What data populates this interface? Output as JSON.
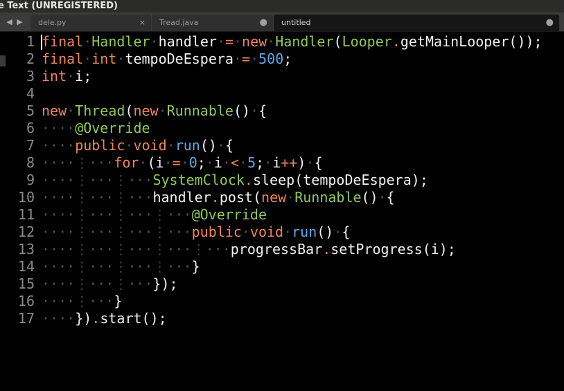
{
  "window": {
    "title": "e Text (UNREGISTERED)"
  },
  "tabbar": {
    "nav_prev": "◀",
    "nav_next": "▶",
    "tabs": [
      {
        "label": "dele.py",
        "marker": "×",
        "active": false
      },
      {
        "label": "Tread.java",
        "marker": "●",
        "active": false
      },
      {
        "label": "untitled",
        "marker": "●",
        "active": true
      }
    ]
  },
  "editor": {
    "line_numbers": [
      "1",
      "2",
      "3",
      "4",
      "5",
      "6",
      "7",
      "8",
      "9",
      "10",
      "11",
      "12",
      "13",
      "14",
      "15",
      "16",
      "17"
    ],
    "lines": [
      "final Handler handler = new Handler(Looper.getMainLooper());",
      "final int tempoDeEspera = 500;",
      "int i;",
      "",
      "new Thread(new Runnable() {",
      "    @Override",
      "    public void run() {",
      "        for (i = 0; i < 5; i++) {",
      "            SystemClock.sleep(tempoDeEspera);",
      "            handler.post(new Runnable() {",
      "                @Override",
      "                public void run() {",
      "                    progressBar.setProgress(i);",
      "                }",
      "            });",
      "        }",
      "    }).start();"
    ]
  },
  "colors": {
    "keyword": "#f0855a",
    "type": "#8fc957",
    "number": "#5fa8e8",
    "background": "#000000",
    "gutter_text": "#8a8a8a"
  }
}
